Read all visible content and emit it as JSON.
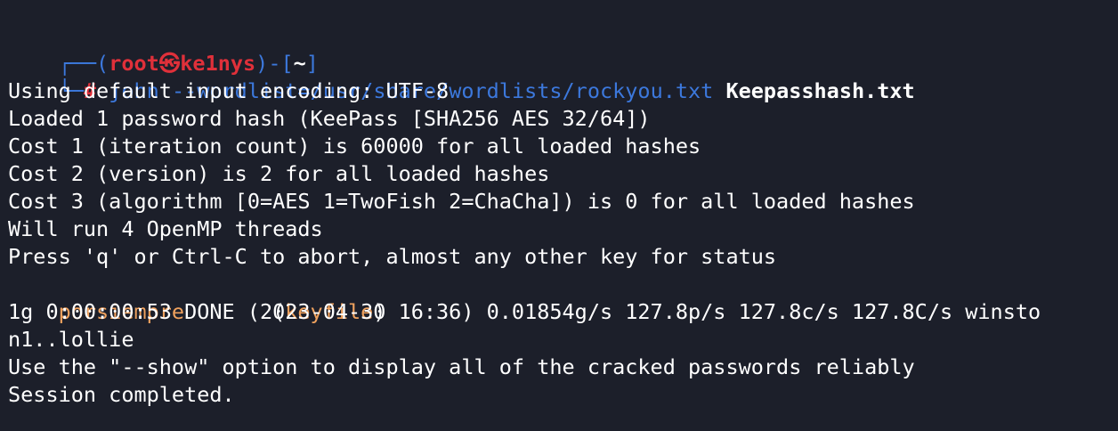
{
  "prompt": {
    "corner_top": "┌──(",
    "user": "root",
    "skull": "㉿",
    "host": "ke1nys",
    "mid": ")-[",
    "dir": "~",
    "close": "]",
    "corner_bottom": "└─",
    "hash": "#"
  },
  "command": {
    "text": "john --wordlist=/usr/share/wordlists/rockyou.txt",
    "file": "Keepasshash.txt"
  },
  "output": {
    "l1": "Using default input encoding: UTF-8",
    "l2": "Loaded 1 password hash (KeePass [SHA256 AES 32/64])",
    "l3": "Cost 1 (iteration count) is 60000 for all loaded hashes",
    "l4": "Cost 2 (version) is 2 for all loaded hashes",
    "l5": "Cost 3 (algorithm [0=AES 1=TwoFish 2=ChaCha]) is 0 for all loaded hashes",
    "l6": "Will run 4 OpenMP threads",
    "l7": "Press 'q' or Ctrl-C to abort, almost any other key for status",
    "cracked_password": "porsiempre",
    "cracked_gap": "       (",
    "cracked_label": "keyfile",
    "cracked_close": ")",
    "l9": "1g 0:00:00:53 DONE (2023-04-30 16:36) 0.01854g/s 127.8p/s 127.8c/s 127.8C/s winsto",
    "l10": "n1..lollie",
    "l11": "Use the \"--show\" option to display all of the cracked passwords reliably",
    "l12": "Session completed."
  }
}
